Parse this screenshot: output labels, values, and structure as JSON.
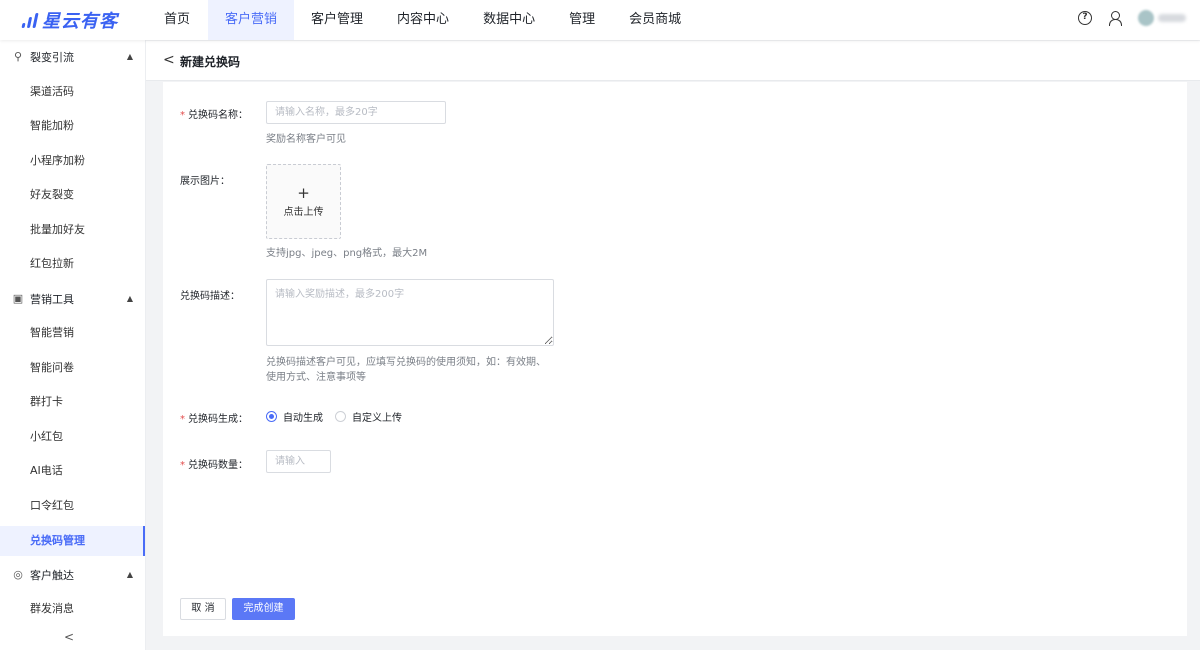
{
  "app": {
    "logo_text": "星云有客"
  },
  "nav": {
    "items": [
      {
        "label": "首页"
      },
      {
        "label": "客户营销",
        "active": true
      },
      {
        "label": "客户管理"
      },
      {
        "label": "内容中心"
      },
      {
        "label": "数据中心"
      },
      {
        "label": "管理"
      },
      {
        "label": "会员商城"
      }
    ]
  },
  "header_right": {
    "help_icon": "?"
  },
  "sidebar": {
    "groups": [
      {
        "label": "裂变引流",
        "icon": "fission-icon",
        "expanded": true,
        "items": [
          "渠道活码",
          "智能加粉",
          "小程序加粉",
          "好友裂变",
          "批量加好友",
          "红包拉新"
        ]
      },
      {
        "label": "营销工具",
        "icon": "gift-icon",
        "expanded": true,
        "items": [
          "智能营销",
          "智能问卷",
          "群打卡",
          "小红包",
          "AI电话",
          "口令红包",
          "兑换码管理"
        ]
      },
      {
        "label": "客户触达",
        "icon": "target-icon",
        "expanded": true,
        "items": [
          "群发消息"
        ]
      }
    ],
    "active_item": "兑换码管理",
    "collapse_icon": "<"
  },
  "page": {
    "back_icon": "<",
    "title": "新建兑换码"
  },
  "form": {
    "name": {
      "label": "兑换码名称：",
      "required": true,
      "placeholder": "请输入名称，最多20字",
      "value": "",
      "hint": "奖励名称客户可见"
    },
    "image": {
      "label": "展示图片：",
      "upload_plus": "+",
      "upload_text": "点击上传",
      "hint": "支持jpg、jpeg、png格式，最大2M"
    },
    "description": {
      "label": "兑换码描述：",
      "placeholder": "请输入奖励描述，最多200字",
      "value": "",
      "hint_line1": "兑换码描述客户可见，应填写兑换码的使用须知，如：有效期、",
      "hint_line2": "使用方式、注意事项等"
    },
    "generation": {
      "label": "兑换码生成：",
      "required": true,
      "options": [
        "自动生成",
        "自定义上传"
      ],
      "selected": "自动生成"
    },
    "quantity": {
      "label": "兑换码数量：",
      "required": true,
      "placeholder": "请输入",
      "value": ""
    }
  },
  "actions": {
    "cancel": "取 消",
    "submit": "完成创建"
  },
  "colors": {
    "accent": "#4a6cf7",
    "required": "#e34d4d",
    "sidebar_active_bg": "#eef2ff"
  }
}
